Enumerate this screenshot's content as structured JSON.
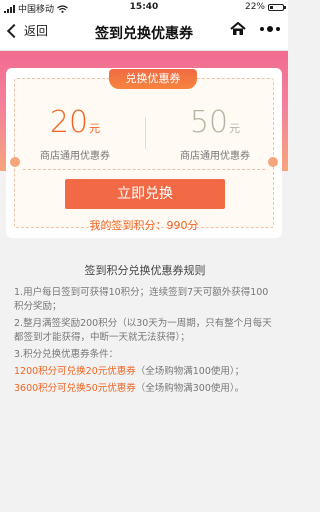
{
  "status_bar": {
    "carrier": "中国移动",
    "time": "15:40",
    "battery_percent": "22%"
  },
  "nav": {
    "back_label": "返回",
    "title": "签到兑换优惠券"
  },
  "card": {
    "tab_label": "兑换优惠券",
    "coupons": [
      {
        "amount": "20",
        "unit": "元",
        "label": "商店通用优惠券"
      },
      {
        "amount": "50",
        "unit": "元",
        "label": "商店通用优惠券"
      }
    ],
    "redeem_label": "立即兑换",
    "points_text": "我的签到积分：990分"
  },
  "rules": {
    "title": "签到积分兑换优惠券规则",
    "line1": "1.用户每日签到可获得10积分；连续签到7天可额外获得100积分奖励；",
    "line2": "2.整月满签奖励200积分（以30天为一周期，只有整个月每天都签到才能获得，中断一天就无法获得）；",
    "line3": "3.积分兑换优惠券条件：",
    "line4_hl": "1200积分可兑换20元优惠券",
    "line4_rest": "（全场购物满100使用）；",
    "line5_hl": "3600积分可兑换50元优惠券",
    "line5_rest": "（全场购物满300使用）。"
  },
  "colors": {
    "accent": "#f26522",
    "button": "#f26a45",
    "hero_pink": "#f26c8f",
    "hero_orange": "#f6a57c"
  }
}
